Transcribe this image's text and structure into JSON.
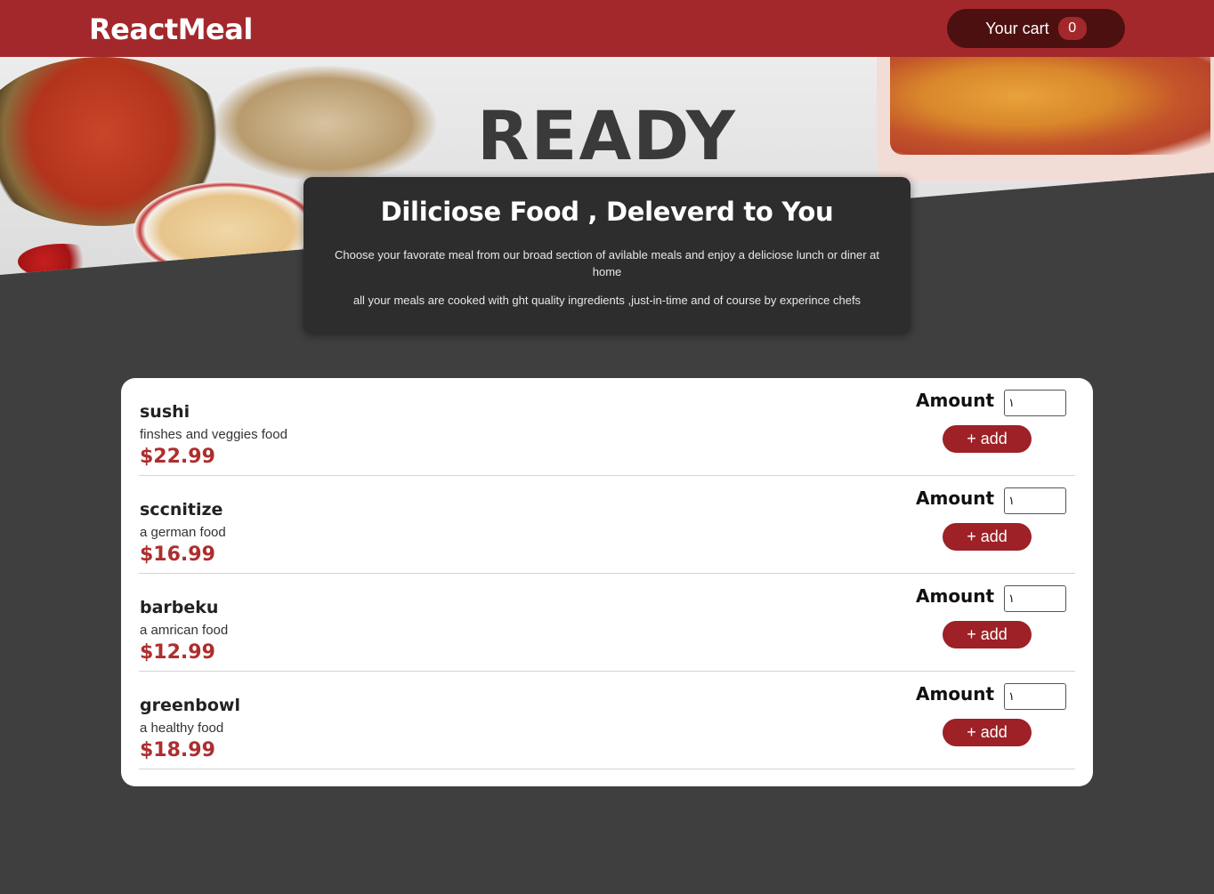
{
  "header": {
    "logo": "ReactMeal",
    "cart_label": "Your cart",
    "cart_count": "0"
  },
  "hero": {
    "image_text": "READY",
    "title": "Diliciose Food , Deleverd to You",
    "paragraph_1": "Choose your favorate meal from our broad section of avilable meals and enjoy a deliciose lunch or diner at home",
    "paragraph_2": "all your meals are cooked with ght quality ingredients ,just-in-time and of course by experince chefs"
  },
  "meals": [
    {
      "name": "sushi",
      "description": "finshes and veggies food",
      "price": "$22.99",
      "amount_label": "Amount",
      "amount_value": "١",
      "add_label": "+ add"
    },
    {
      "name": "sccnitize",
      "description": "a german food",
      "price": "$16.99",
      "amount_label": "Amount",
      "amount_value": "١",
      "add_label": "+ add"
    },
    {
      "name": "barbeku",
      "description": "a amrican food",
      "price": "$12.99",
      "amount_label": "Amount",
      "amount_value": "١",
      "add_label": "+ add"
    },
    {
      "name": "greenbowl",
      "description": "a healthy food",
      "price": "$18.99",
      "amount_label": "Amount",
      "amount_value": "١",
      "add_label": "+ add"
    }
  ],
  "colors": {
    "header_bg": "#a3282b",
    "cart_bg": "#4d1010",
    "page_bg": "#3f3f3f",
    "summary_bg": "#2d2d2d",
    "price": "#ad2e2e",
    "add_button": "#9d2126"
  }
}
